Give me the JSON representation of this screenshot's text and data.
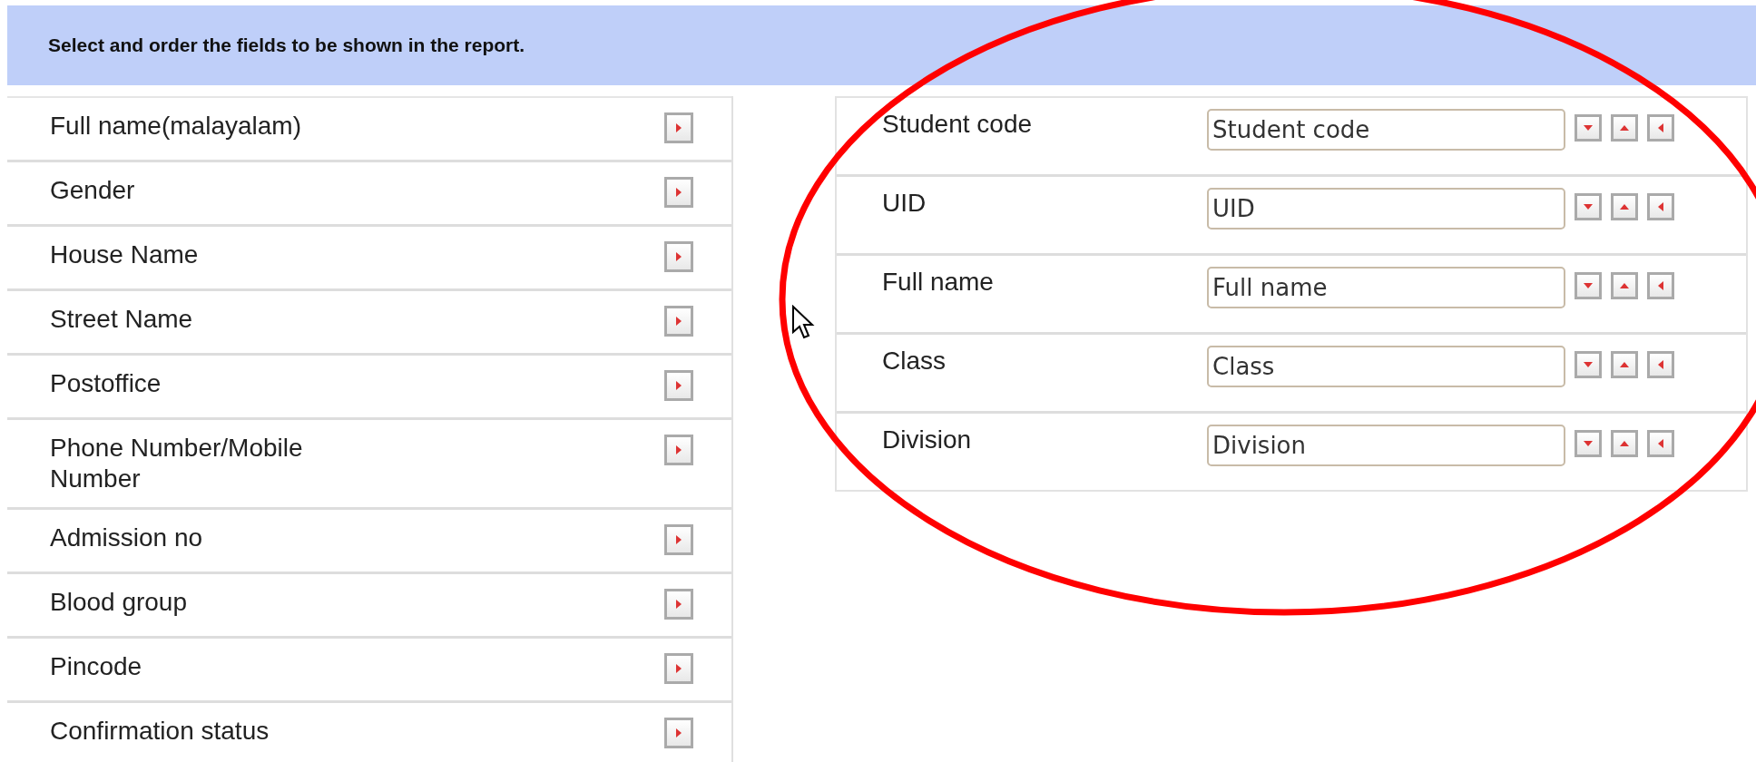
{
  "instruction": "Select and order the fields to be shown in the report.",
  "available_fields": [
    {
      "label": "Full name(malayalam)"
    },
    {
      "label": "Gender"
    },
    {
      "label": "House Name"
    },
    {
      "label": "Street Name"
    },
    {
      "label": "Postoffice"
    },
    {
      "label": "Phone Number/Mobile Number"
    },
    {
      "label": "Admission no"
    },
    {
      "label": "Blood group"
    },
    {
      "label": "Pincode"
    },
    {
      "label": "Confirmation status"
    }
  ],
  "selected_fields": [
    {
      "label": "Student code",
      "value": "Student code"
    },
    {
      "label": "UID",
      "value": "UID"
    },
    {
      "label": "Full name",
      "value": "Full name"
    },
    {
      "label": "Class",
      "value": "Class"
    },
    {
      "label": "Division",
      "value": "Division"
    }
  ]
}
